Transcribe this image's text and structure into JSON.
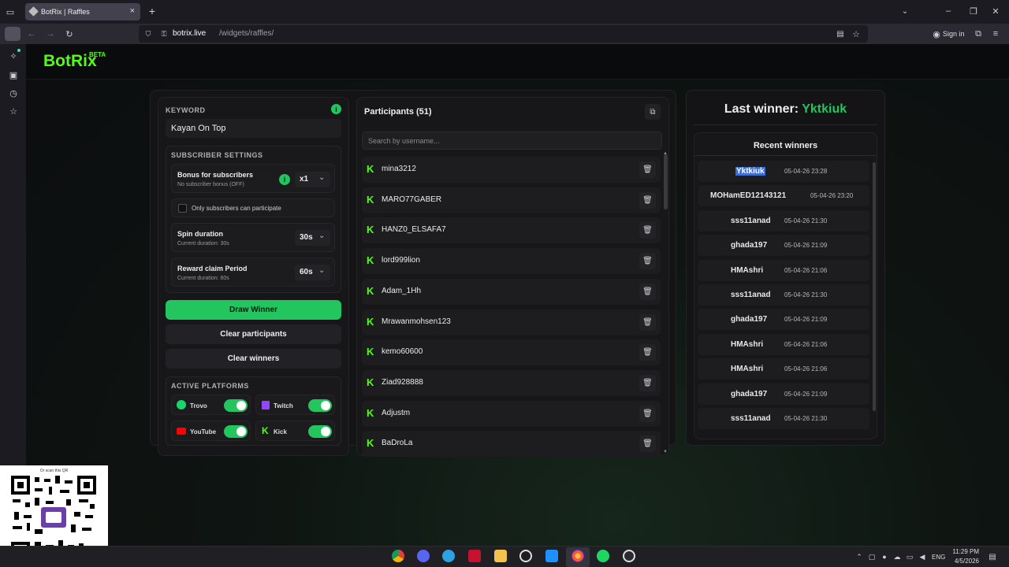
{
  "browser": {
    "tab_title": "BotRix | Raffles",
    "url_host": "botrix.live",
    "url_path": "/widgets/raffles/",
    "sign_in": "Sign in"
  },
  "brand": {
    "name": "BotRix",
    "badge": "BETA"
  },
  "settings": {
    "keyword_label": "KEYWORD",
    "keyword_value": "Kayan On Top",
    "subscriber_settings_label": "SUBSCRIBER SETTINGS",
    "bonus_title": "Bonus for subscribers",
    "bonus_sub": "No subscriber bonus (OFF)",
    "bonus_value": "x1",
    "only_subs_label": "Only subscribers can participate",
    "spin_title": "Spin duration",
    "spin_sub": "Current duration: 30s",
    "spin_value": "30s",
    "reward_title": "Reward claim Period",
    "reward_sub": "Current duration: 60s",
    "reward_value": "60s",
    "draw_button": "Draw Winner",
    "clear_participants_button": "Clear participants",
    "clear_winners_button": "Clear winners",
    "active_platforms_label": "ACTIVE PLATFORMS",
    "platforms": [
      "Trovo",
      "Twitch",
      "YouTube",
      "Kick"
    ]
  },
  "participants": {
    "title": "Participants (51)",
    "search_placeholder": "Search by username...",
    "items": [
      "mina3212",
      "MARO77GABER",
      "HANZ0_ELSAFA7",
      "lord999lion",
      "Adam_1Hh",
      "Mrawanmohsen123",
      "kemo60600",
      "Ziad928888",
      "Adjustm",
      "BaDroLa"
    ]
  },
  "winners": {
    "last_label": "Last winner:",
    "last_name": "Yktkiuk",
    "recent_title": "Recent winners",
    "items": [
      {
        "name": "Yktkiuk",
        "date": "05-04-26 23:28"
      },
      {
        "name": "MOHamED12143121",
        "date": "05-04-26 23:20"
      },
      {
        "name": "sss11anad",
        "date": "05-04-26 21:30"
      },
      {
        "name": "ghada197",
        "date": "05-04-26 21:09"
      },
      {
        "name": "HMAshri",
        "date": "05-04-26 21:06"
      },
      {
        "name": "sss11anad",
        "date": "05-04-26 21:30"
      },
      {
        "name": "ghada197",
        "date": "05-04-26 21:09"
      },
      {
        "name": "HMAshri",
        "date": "05-04-26 21:06"
      },
      {
        "name": "HMAshri",
        "date": "05-04-26 21:06"
      },
      {
        "name": "ghada197",
        "date": "05-04-26 21:09"
      },
      {
        "name": "sss11anad",
        "date": "05-04-26 21:30"
      }
    ]
  },
  "qr": {
    "caption": "Or scan this QR"
  },
  "taskbar": {
    "lang": "ENG",
    "time": "11:29 PM",
    "date": "4/5/2026"
  },
  "colors": {
    "accent": "#22c55e",
    "brand_green": "#53fc18",
    "bg": "#0c0d0f"
  }
}
